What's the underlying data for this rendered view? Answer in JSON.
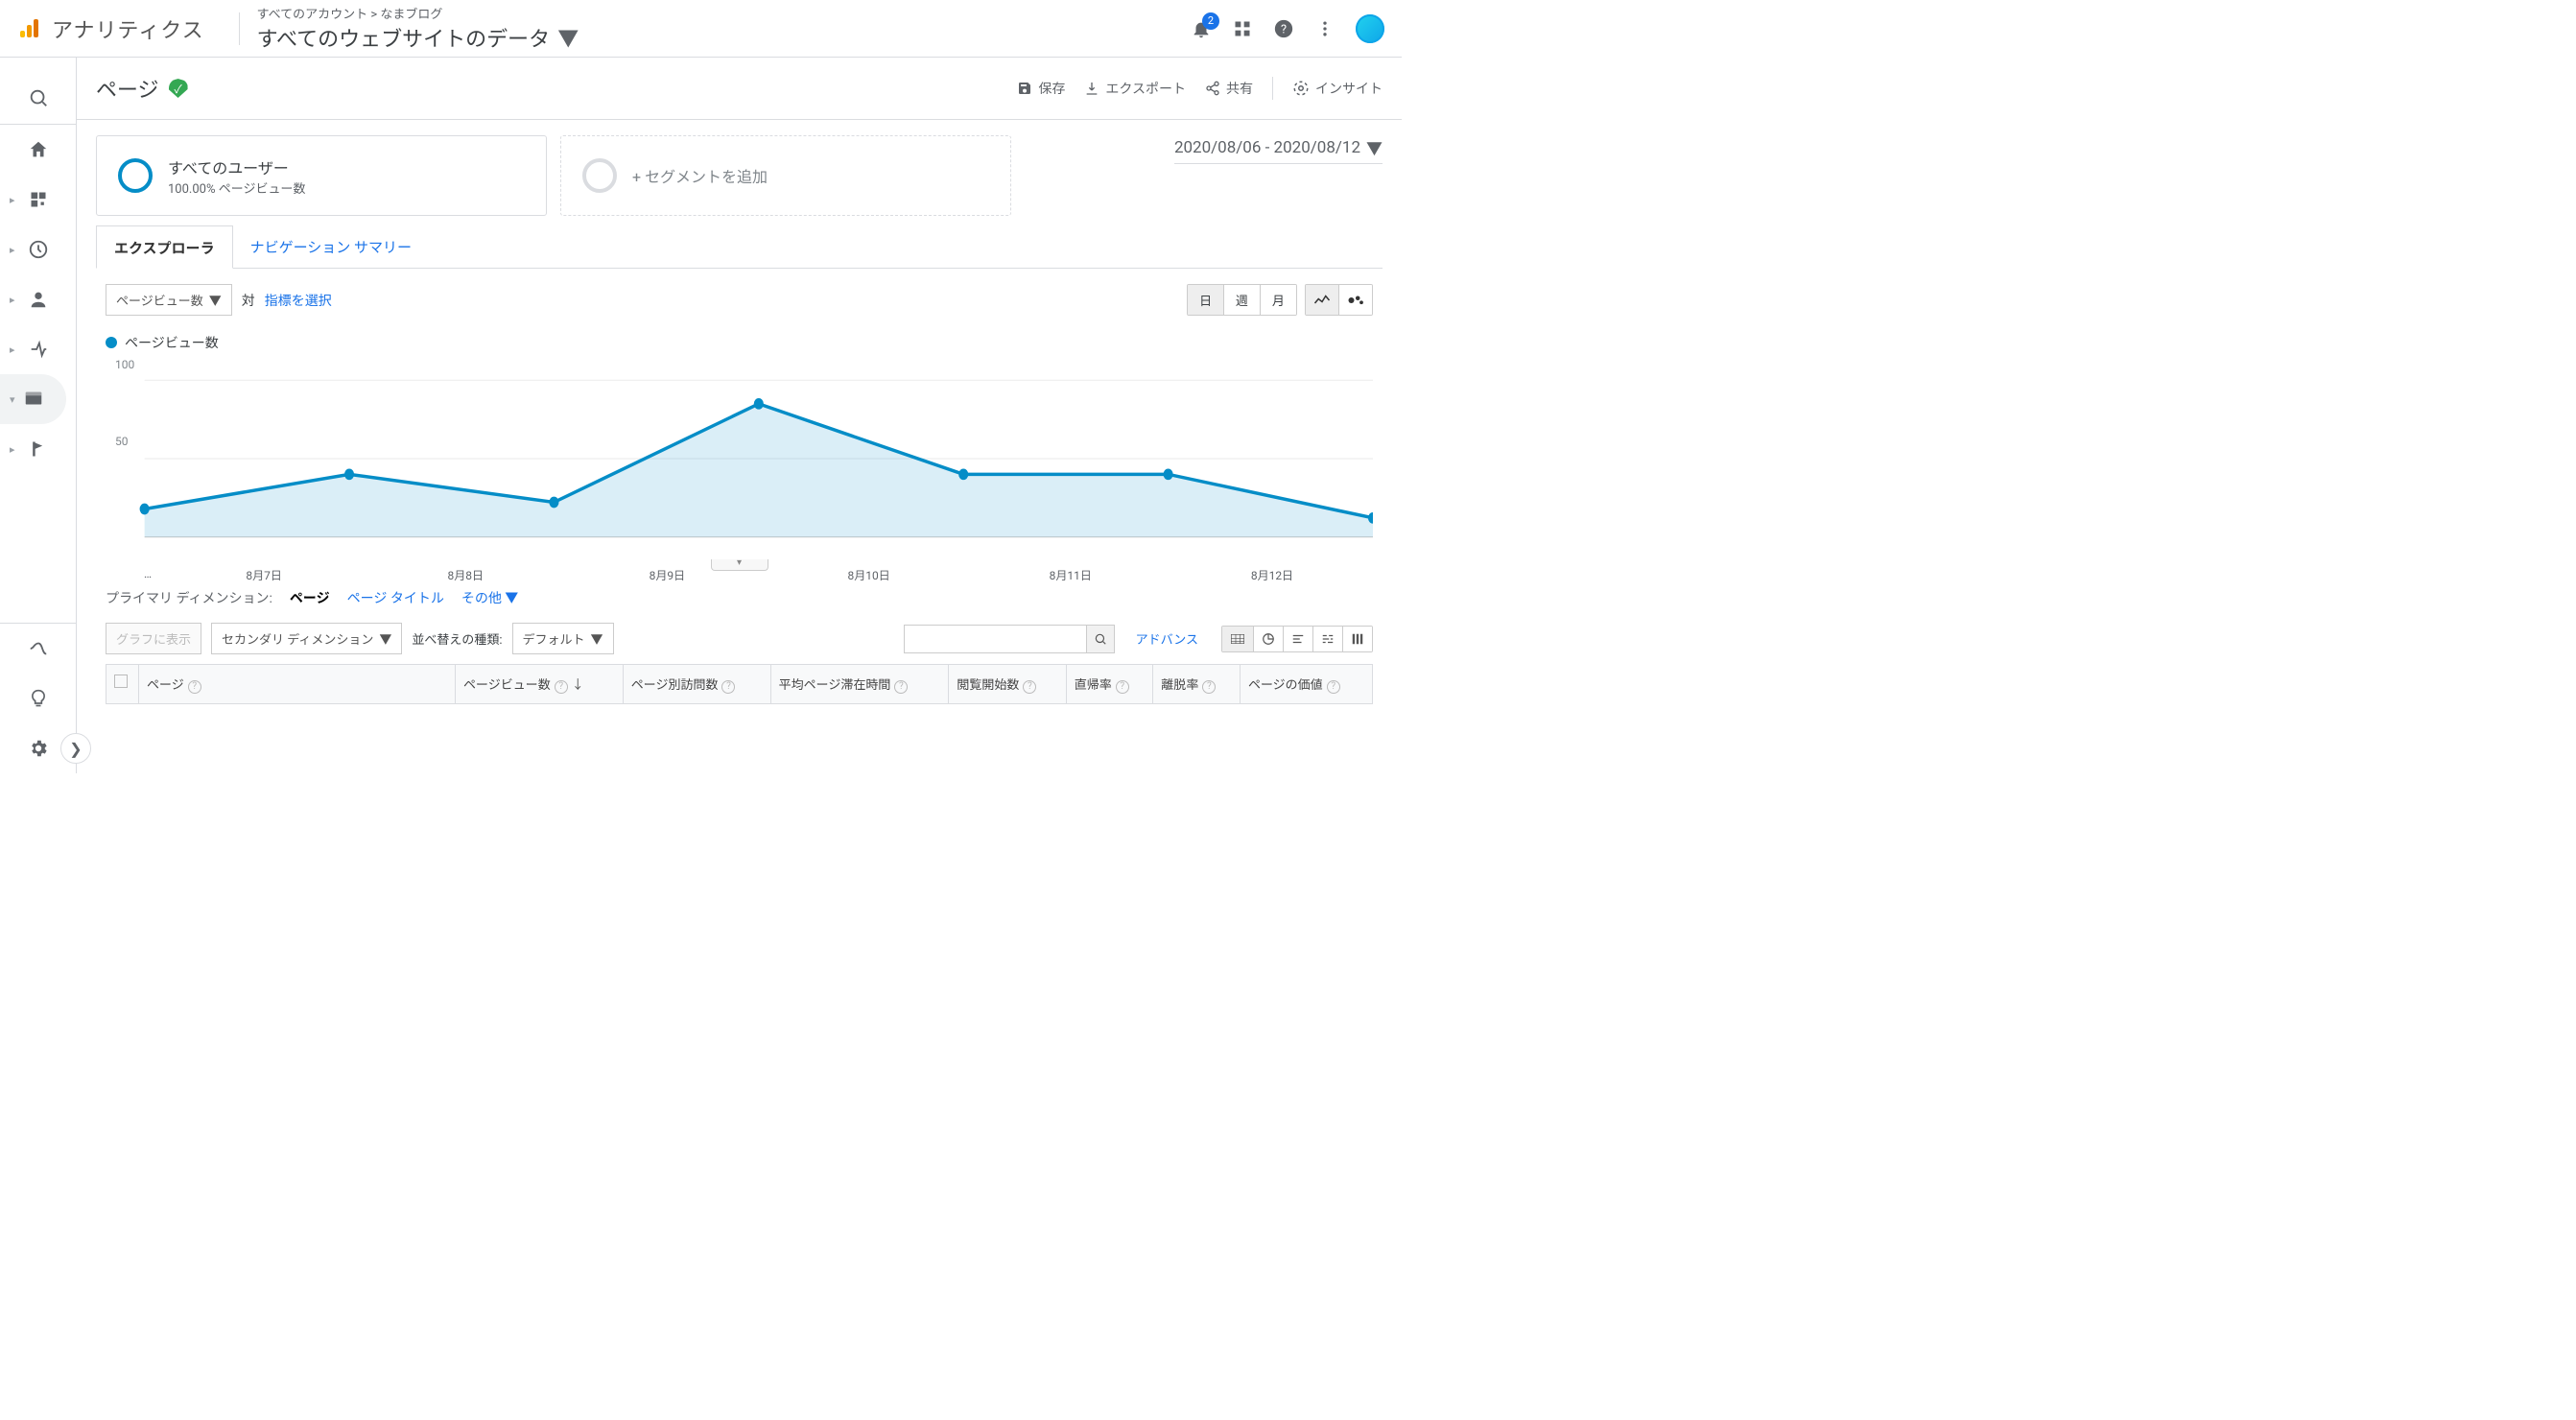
{
  "header": {
    "brand": "アナリティクス",
    "breadcrumb_top": "すべてのアカウント > なまブログ",
    "breadcrumb_main": "すべてのウェブサイトのデータ",
    "notifications_badge": "2"
  },
  "page": {
    "title": "ページ",
    "toolbar": {
      "save": "保存",
      "export": "エクスポート",
      "share": "共有",
      "insight": "インサイト"
    }
  },
  "segments": {
    "all_users_title": "すべてのユーザー",
    "all_users_sub": "100.00% ページビュー数",
    "add_segment": "+ セグメントを追加"
  },
  "date_range": "2020/08/06 - 2020/08/12",
  "tabs": {
    "explorer": "エクスプローラ",
    "nav_summary": "ナビゲーション サマリー"
  },
  "chart_controls": {
    "metric_dropdown": "ページビュー数",
    "vs": "対",
    "select_metric": "指標を選択",
    "granularity": {
      "day": "日",
      "week": "週",
      "month": "月"
    }
  },
  "legend": {
    "label": "ページビュー数"
  },
  "chart_data": {
    "type": "line",
    "categories": [
      "…",
      "8月7日",
      "8月8日",
      "8月9日",
      "8月10日",
      "8月11日",
      "8月12日"
    ],
    "values": [
      18,
      40,
      22,
      85,
      40,
      40,
      12
    ],
    "title": "",
    "xlabel": "",
    "ylabel": "",
    "ylim": [
      0,
      100
    ],
    "yticks": [
      50,
      100
    ]
  },
  "dimension": {
    "label": "プライマリ ディメンション:",
    "active": "ページ",
    "page_title": "ページ タイトル",
    "other": "その他"
  },
  "filters": {
    "graph_btn": "グラフに表示",
    "secondary_dim": "セカンダリ ディメンション",
    "sort_label": "並べ替えの種類:",
    "sort_value": "デフォルト",
    "advanced": "アドバンス"
  },
  "table": {
    "cols": {
      "page": "ページ",
      "pageviews": "ページビュー数",
      "unique": "ページ別訪問数",
      "avg_time": "平均ページ滞在時間",
      "entrances": "閲覧開始数",
      "bounce": "直帰率",
      "exit": "離脱率",
      "value": "ページの価値"
    }
  }
}
